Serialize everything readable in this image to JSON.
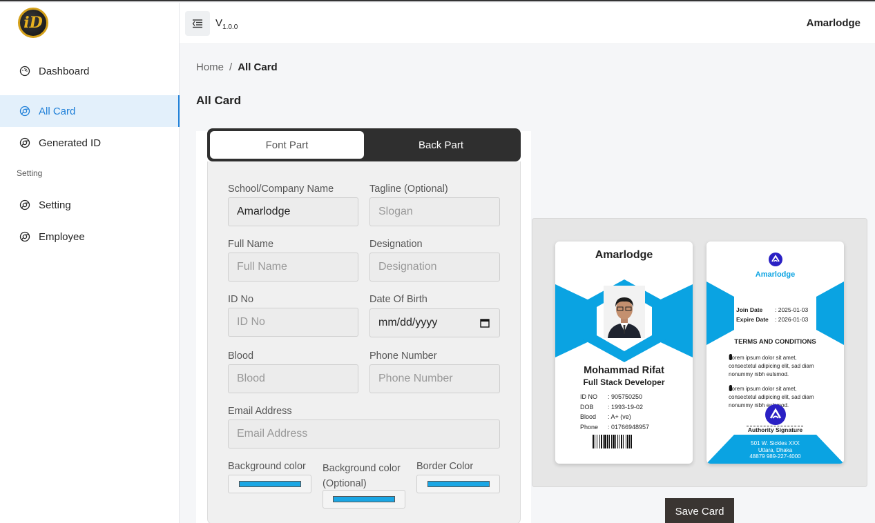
{
  "sidebar": {
    "logo_text": "iD",
    "items": [
      {
        "label": "Dashboard",
        "icon": "dashboard-gauge-icon"
      },
      {
        "label": "All Card",
        "icon": "chrome-circle-icon"
      },
      {
        "label": "Generated ID",
        "icon": "chrome-circle-icon"
      }
    ],
    "section_label": "Setting",
    "setting_items": [
      {
        "label": "Setting",
        "icon": "chrome-circle-icon"
      },
      {
        "label": "Employee",
        "icon": "chrome-circle-icon"
      }
    ]
  },
  "topbar": {
    "version_prefix": "V",
    "version_sub": "1.0.0",
    "user": "Amarlodge",
    "menu_icon": "menu-collapse-icon"
  },
  "breadcrumb": {
    "home": "Home",
    "sep": "/",
    "current": "All Card"
  },
  "page_title": "All Card",
  "tabs": {
    "front": "Font Part",
    "back": "Back Part"
  },
  "form": {
    "company_label": "School/Company Name",
    "company_value": "Amarlodge",
    "tagline_label": "Tagline (Optional)",
    "tagline_placeholder": "Slogan",
    "fullname_label": "Full Name",
    "fullname_placeholder": "Full Name",
    "designation_label": "Designation",
    "designation_placeholder": "Designation",
    "idno_label": "ID No",
    "idno_placeholder": "ID No",
    "dob_label": "Date Of Birth",
    "dob_placeholder": "mm/dd/yyyy",
    "blood_label": "Blood",
    "blood_placeholder": "Blood",
    "phone_label": "Phone Number",
    "phone_placeholder": "Phone Number",
    "email_label": "Email Address",
    "email_placeholder": "Email Address",
    "bg_color_label": "Background color",
    "bg_color_opt_label_1": "Background color",
    "bg_color_opt_label_2": "(Optional)",
    "border_color_label": "Border Color",
    "swatch_color": "#1aa6e4"
  },
  "front_card": {
    "company": "Amarlodge",
    "name": "Mohammad Rifat",
    "designation": "Full Stack Developer",
    "fields": [
      {
        "k": "ID NO",
        "v": ": 905750250"
      },
      {
        "k": "DOB",
        "v": ": 1993-19-02"
      },
      {
        "k": "Blood",
        "v": ": A+ (ve)"
      },
      {
        "k": "Phone",
        "v": ": 01766948957"
      }
    ],
    "accent": "#0aa3e2"
  },
  "back_card": {
    "brand": "Amarlodge",
    "join_label": "Join Date",
    "join_value": ": 2025-01-03",
    "expire_label": "Expire Date",
    "expire_value": ": 2026-01-03",
    "terms_title": "TERMS AND CONDITIONS",
    "terms": [
      "Lorem ipsum dolor sit amet, consectetul adipicing elit, sad diam nonummy nibh eulsmod.",
      "Lorem ipsum dolor sit amet, consectetul adipicing elit, sad diam nonummy nibh eulsmod."
    ],
    "signature_label": "Authority Signature",
    "address_1": "501 W. Sickles XXX",
    "address_2": "Uttara, Dhaka",
    "address_3": "48879 989-227-4000"
  },
  "save_button": "Save Card"
}
